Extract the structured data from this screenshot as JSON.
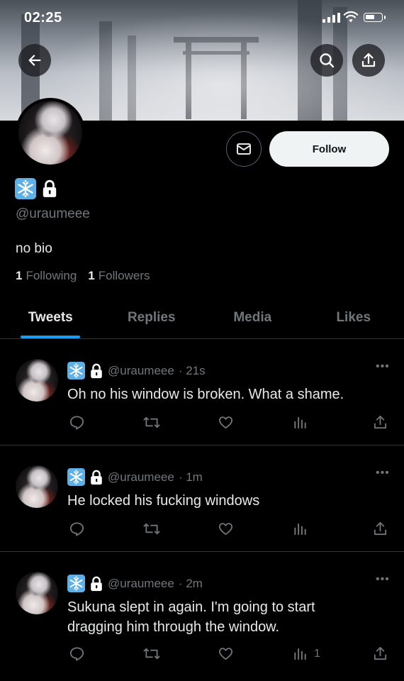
{
  "status_bar": {
    "time": "02:25"
  },
  "profile": {
    "handle": "@uraumeee",
    "bio": "no bio",
    "following_count": "1",
    "following_label": "Following",
    "followers_count": "1",
    "followers_label": "Followers",
    "follow_button": "Follow"
  },
  "tabs": [
    {
      "label": "Tweets",
      "active": true
    },
    {
      "label": "Replies",
      "active": false
    },
    {
      "label": "Media",
      "active": false
    },
    {
      "label": "Likes",
      "active": false
    }
  ],
  "tweets": [
    {
      "handle": "@uraumeee",
      "time": "· 21s",
      "text": "Oh no his window is broken. What a shame.",
      "views": ""
    },
    {
      "handle": "@uraumeee",
      "time": "· 1m",
      "text": "He locked his fucking windows",
      "views": ""
    },
    {
      "handle": "@uraumeee",
      "time": "· 2m",
      "text": "Sukuna slept in again. I'm going to start dragging him through the window.",
      "views": "1"
    }
  ],
  "colors": {
    "accent": "#1d9bf0",
    "background": "#000000",
    "muted": "#71767b"
  },
  "icons": [
    "back-arrow-icon",
    "search-icon",
    "share-icon",
    "mail-icon",
    "snowflake-icon",
    "lock-icon",
    "reply-icon",
    "retweet-icon",
    "like-icon",
    "views-icon",
    "more-icon"
  ]
}
